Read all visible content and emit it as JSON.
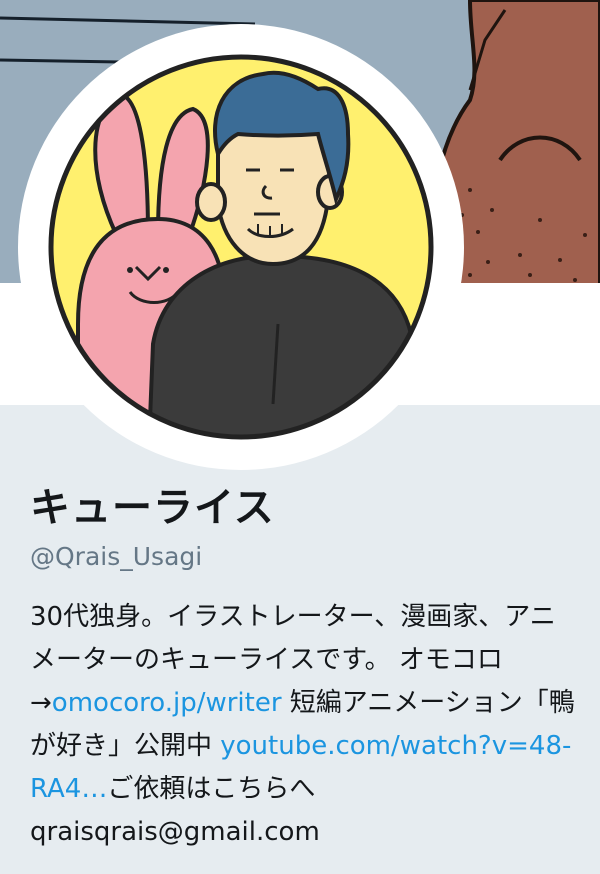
{
  "profile": {
    "display_name": "キューライス",
    "handle": "@Qrais_Usagi",
    "bio": {
      "text1": "30代独身。イラストレーター、漫画家、アニメーターのキューライスです。 オモコロ→",
      "link1": "omocoro.jp/writer",
      "text2": " 短編アニメーション「鴨が好き」公開中 ",
      "link2": "youtube.com/watch?v=48-RA4…",
      "text3": "ご依頼はこちらへqraisqrais@gmail.com"
    }
  },
  "colors": {
    "page_bg": "#e6ecf0",
    "link": "#1b95e0",
    "handle": "#657786",
    "text": "#14171a",
    "banner_sky": "#99adbd",
    "banner_brown": "#a0604e",
    "avatar_bg": "#fff06e"
  }
}
